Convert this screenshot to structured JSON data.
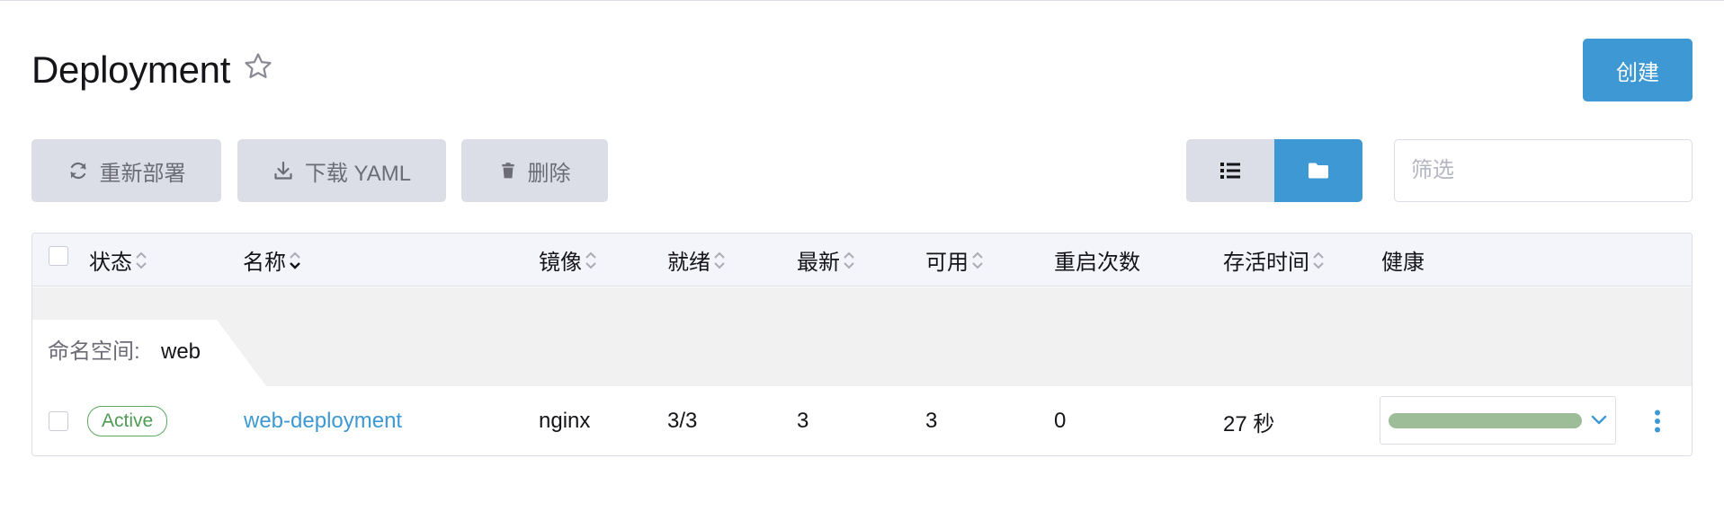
{
  "header": {
    "title": "Deployment",
    "create_label": "创建"
  },
  "toolbar": {
    "redeploy_label": "重新部署",
    "download_label": "下载 YAML",
    "delete_label": "删除"
  },
  "filter": {
    "placeholder": "筛选",
    "value": ""
  },
  "table": {
    "columns": [
      "状态",
      "名称",
      "镜像",
      "就绪",
      "最新",
      "可用",
      "重启次数",
      "存活时间",
      "健康"
    ],
    "group": {
      "label": "命名空间:",
      "value": "web"
    },
    "rows": [
      {
        "status": "Active",
        "name": "web-deployment",
        "image": "nginx",
        "ready": "3/3",
        "up_to_date": "3",
        "available": "3",
        "restarts": "0",
        "age": "27 秒",
        "health": 1.0
      }
    ]
  },
  "colors": {
    "accent": "#3d98d3",
    "button_gray": "#dcdee7",
    "active_green": "#5ca862",
    "health_bar": "#9dbd98"
  },
  "icons": [
    "star-icon",
    "refresh-icon",
    "download-icon",
    "trash-icon",
    "list-icon",
    "folder-icon",
    "sort-icon",
    "chevron-down-icon",
    "kebab-menu-icon"
  ]
}
